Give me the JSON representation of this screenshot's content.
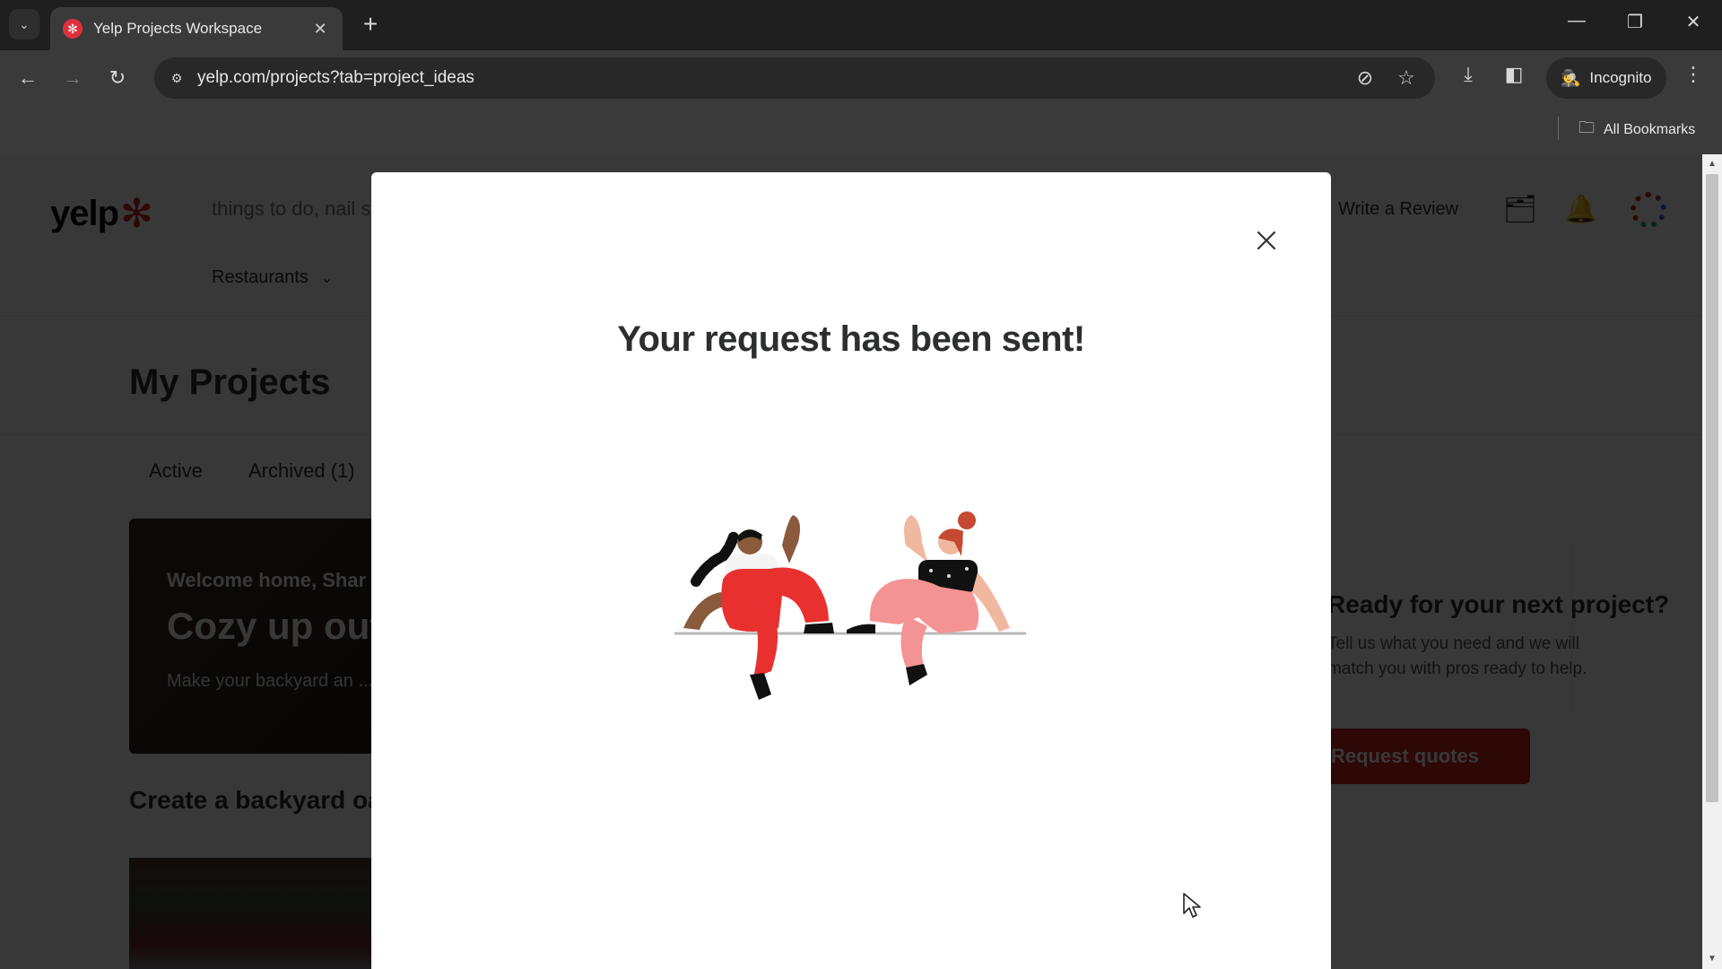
{
  "browser": {
    "tab": {
      "title": "Yelp Projects Workspace",
      "favicon": "yelp-burst-icon"
    },
    "new_tab_label": "+",
    "url": "yelp.com/projects?tab=project_ideas",
    "incognito_label": "Incognito",
    "all_bookmarks_label": "All Bookmarks",
    "icons": {
      "tab_search": "⌄",
      "tab_close": "✕",
      "back": "←",
      "forward": "→",
      "reload": "↻",
      "site_info": "⚙",
      "eye_off": "⊘",
      "bookmark_star": "☆",
      "download": "⤓",
      "side_panel": "◧",
      "incognito": "🕵",
      "menu": "⋮",
      "folder": "🗀",
      "minimize": "—",
      "restore": "❐",
      "close": "✕"
    }
  },
  "page": {
    "logo_text": "yelp",
    "logo_burst": "✻",
    "search_placeholder": "things to do, nail salons, plumbers",
    "category_menu": "Restaurants",
    "category_chevron": "⌄",
    "write_review": "Write a Review",
    "header_icons": {
      "projects": "🗂",
      "notifications": "🔔"
    },
    "title": "My Projects",
    "tabs": [
      {
        "label": "Active"
      },
      {
        "label": "Archived (1)"
      }
    ],
    "hero": {
      "welcome": "Welcome home, Shar",
      "title": "Cozy up outdoors",
      "subtitle": "Make your backyard an ..."
    },
    "next_project": {
      "title": "Ready for your next project?",
      "description": "Tell us what you need and we will match you with pros ready to help.",
      "button": "Request quotes"
    },
    "section_title": "Create a backyard oasis"
  },
  "modal": {
    "title": "Your request has been sent!",
    "close_label": "Close",
    "illustration": "two-people-waving"
  },
  "colors": {
    "brand_red": "#d32323",
    "modal_bg": "#ffffff",
    "overlay": "rgba(0,0,0,0.78)",
    "title_text": "#2d2e2f"
  }
}
